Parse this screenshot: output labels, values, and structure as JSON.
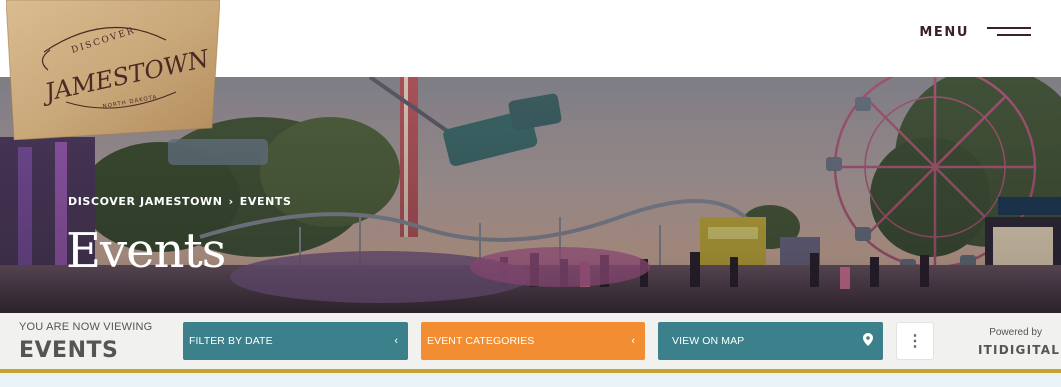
{
  "header": {
    "logo": {
      "line1": "DISCOVER",
      "line2": "JAMESTOWN",
      "line3": "NORTH DAKOTA"
    },
    "menu_label": "MENU"
  },
  "hero": {
    "breadcrumb": {
      "home": "DISCOVER JAMESTOWN",
      "separator": "›",
      "current": "EVENTS"
    },
    "title": "Events"
  },
  "filterbar": {
    "viewing_label": "YOU ARE NOW VIEWING",
    "viewing_value": "EVENTS",
    "buttons": [
      {
        "label": "FILTER BY DATE",
        "icon": "chevron-left-icon",
        "color": "#3c808b"
      },
      {
        "label": "EVENT CATEGORIES",
        "icon": "chevron-left-icon",
        "color": "#f38d31"
      },
      {
        "label": "VIEW ON MAP",
        "icon": "map-pin-icon",
        "color": "#3c808b"
      }
    ],
    "more_icon": "more-vertical-icon",
    "powered_by_label": "Powered by",
    "powered_by_brand": "ITIDIGITAL"
  },
  "colors": {
    "accent_gold": "#c6a232",
    "teal": "#3c808b",
    "orange": "#f38d31",
    "brand_dark": "#3b1f2b"
  }
}
